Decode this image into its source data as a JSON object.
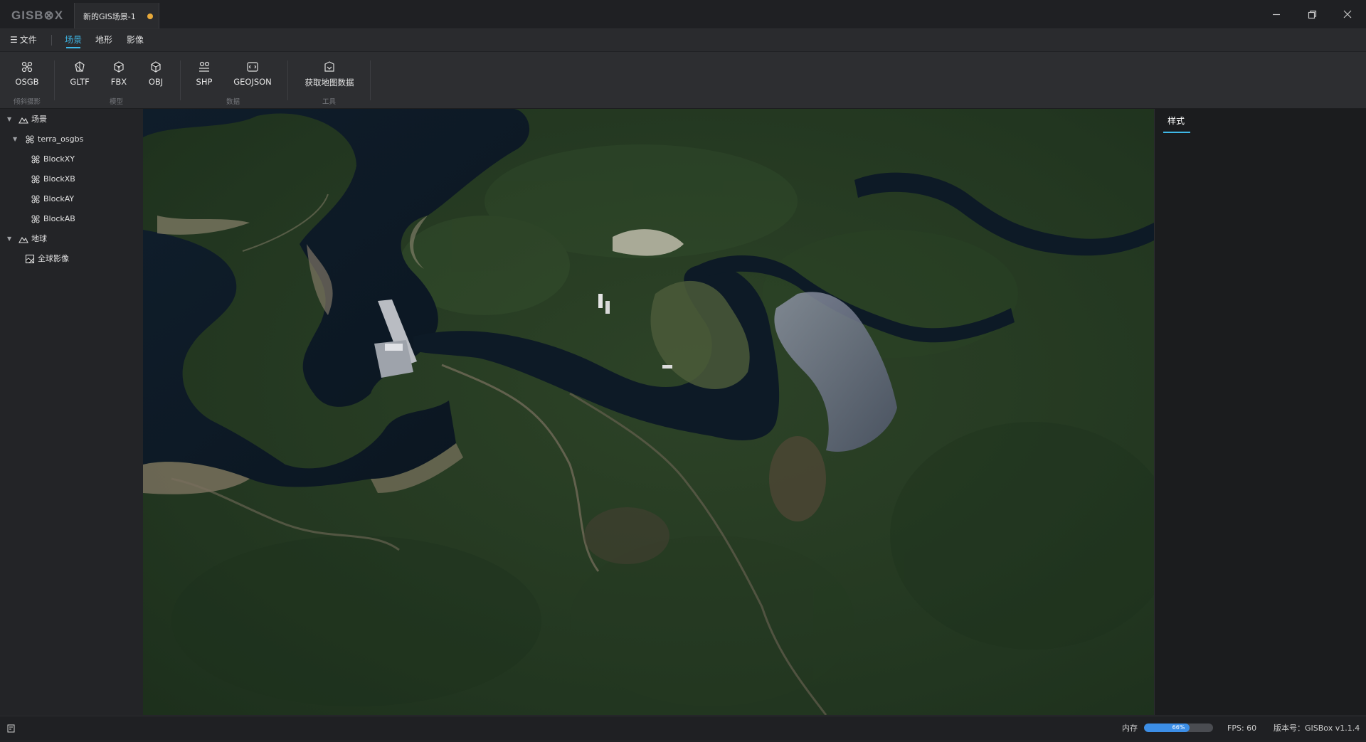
{
  "app": {
    "logo": "GISB⊗X"
  },
  "tab": {
    "title": "新的GIS场景-1",
    "unsaved_dot_color": "#e8a93a"
  },
  "menu": {
    "file": "文件",
    "tabs": [
      {
        "label": "场景",
        "active": true
      },
      {
        "label": "地形",
        "active": false
      },
      {
        "label": "影像",
        "active": false
      }
    ]
  },
  "toolbar": {
    "osgb": "OSGB",
    "gltf": "GLTF",
    "fbx": "FBX",
    "obj": "OBJ",
    "shp": "SHP",
    "geojson": "GEOJSON",
    "get_map_data": "获取地图数据",
    "groups": {
      "oblique": "倾斜摄影",
      "model": "模型",
      "data": "数据",
      "tools": "工具"
    }
  },
  "tree": [
    {
      "label": "场景",
      "icon": "mountain-icon"
    },
    {
      "label": "terra_osgbs",
      "icon": "osgb-node-icon"
    },
    {
      "label": "BlockXY",
      "icon": "osgb-node-icon"
    },
    {
      "label": "BlockXB",
      "icon": "osgb-node-icon"
    },
    {
      "label": "BlockAY",
      "icon": "osgb-node-icon"
    },
    {
      "label": "BlockAB",
      "icon": "osgb-node-icon"
    },
    {
      "label": "地球",
      "icon": "mountain-icon"
    },
    {
      "label": "全球影像",
      "icon": "imagery-icon"
    }
  ],
  "right_panel": {
    "tab": "样式"
  },
  "status": {
    "memory_label": "内存",
    "memory_percent": 66,
    "memory_text": "66%",
    "fps": "FPS: 60",
    "version": "版本号：GISBox v1.1.4"
  },
  "colors": {
    "accent": "#3fb8e8",
    "memory_bar": "#3c8ee6"
  }
}
